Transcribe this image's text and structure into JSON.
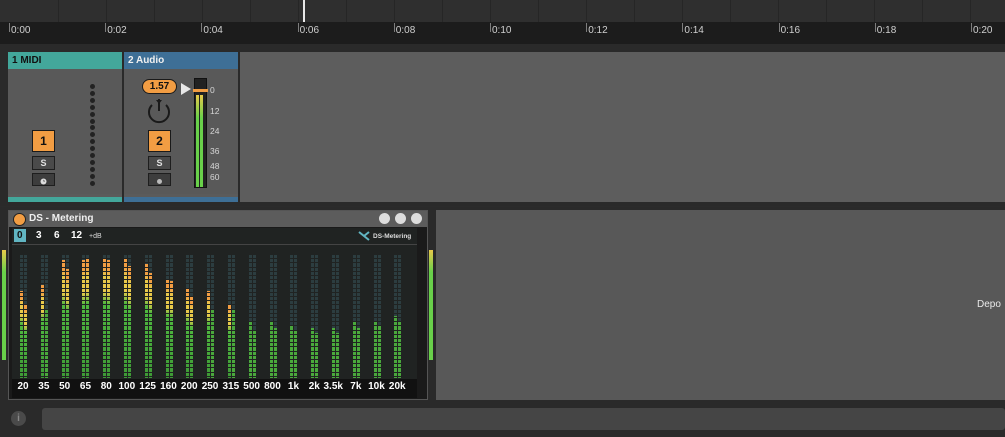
{
  "timeline": {
    "labels": [
      "0:00",
      "0:02",
      "0:04",
      "0:06",
      "0:08",
      "0:10",
      "0:12",
      "0:14",
      "0:16",
      "0:18",
      "0:20"
    ]
  },
  "tracks": [
    {
      "title": "1 MIDI",
      "number": "1",
      "solo": "S",
      "header_color": "#43a79b"
    },
    {
      "title": "2 Audio",
      "number": "2",
      "solo": "S",
      "header_color": "#3e6f96",
      "level": "1.57",
      "meter_scale": [
        "0",
        "12",
        "24",
        "36",
        "48",
        "60"
      ]
    }
  ],
  "device": {
    "name": "DS - Metering",
    "db_options": [
      "0",
      "3",
      "6",
      "12"
    ],
    "db_unit": "+dB",
    "selected_db": "0",
    "logo": "DS-Metering",
    "freq_labels": [
      "20",
      "35",
      "50",
      "65",
      "80",
      "100",
      "125",
      "160",
      "200",
      "250",
      "315",
      "500",
      "800",
      "1k",
      "2k",
      "3.5k",
      "7k",
      "10k",
      "20k"
    ],
    "bar_levels": [
      [
        0.7,
        0.6
      ],
      [
        0.75,
        0.55
      ],
      [
        0.95,
        0.88
      ],
      [
        0.95,
        0.97
      ],
      [
        0.97,
        0.95
      ],
      [
        0.97,
        0.9
      ],
      [
        0.92,
        0.85
      ],
      [
        0.8,
        0.78
      ],
      [
        0.72,
        0.65
      ],
      [
        0.7,
        0.55
      ],
      [
        0.6,
        0.55
      ],
      [
        0.45,
        0.38
      ],
      [
        0.45,
        0.4
      ],
      [
        0.42,
        0.38
      ],
      [
        0.4,
        0.36
      ],
      [
        0.4,
        0.36
      ],
      [
        0.45,
        0.4
      ],
      [
        0.45,
        0.42
      ],
      [
        0.5,
        0.45
      ]
    ]
  },
  "drop_area": {
    "text": "Depo"
  },
  "colors": {
    "accent": "#f29d43",
    "midi": "#43a79b",
    "audio": "#3e6f96",
    "meter_green": "#69d14a"
  },
  "icons": {
    "info": "info-icon",
    "power": "power-icon",
    "device_buttons": [
      "collapse-icon",
      "hot-swap-icon",
      "save-preset-icon"
    ]
  }
}
